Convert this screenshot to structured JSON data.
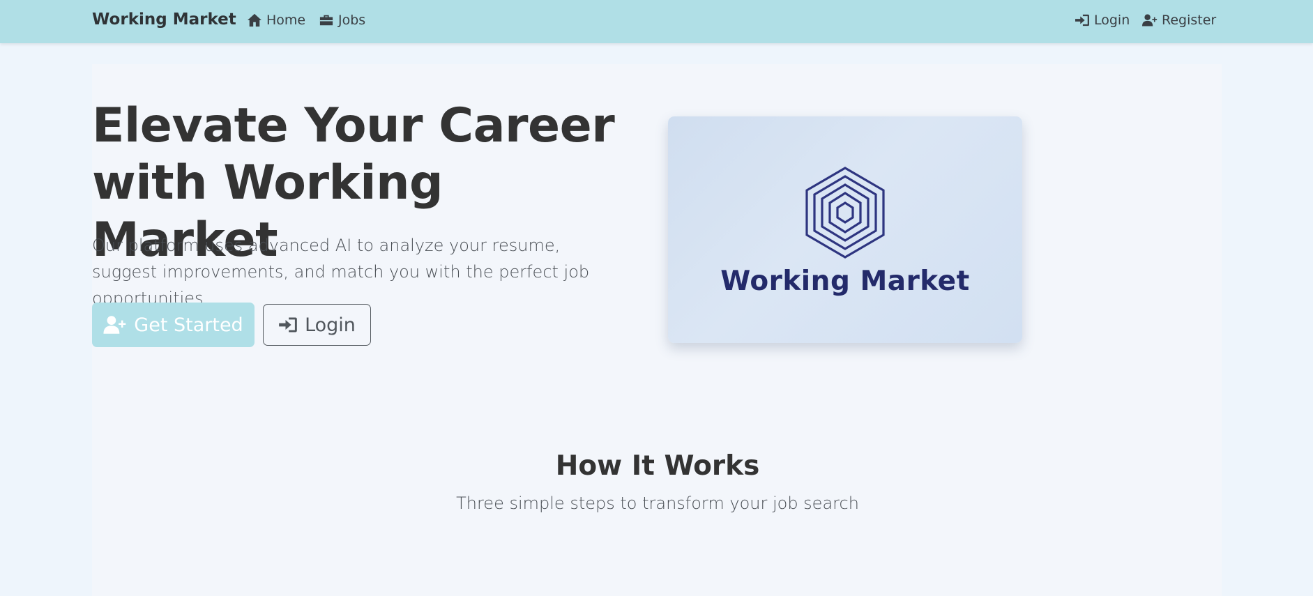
{
  "navbar": {
    "brand": "Working Market",
    "links": {
      "home": "Home",
      "jobs": "Jobs",
      "login": "Login",
      "register": "Register"
    }
  },
  "hero": {
    "title_line1": "Elevate Your Career",
    "title_line2": "with Working Market",
    "subtitle": "Our platform uses advanced AI to analyze your resume, suggest improvements, and match you with the perfect job opportunities.",
    "primary_button": "Get Started",
    "secondary_button": "Login",
    "logo_wordmark": "Working Market"
  },
  "how_it_works": {
    "title": "How It Works",
    "subtitle": "Three simple steps to transform your job search"
  },
  "colors": {
    "navbar_bg": "#b0dfe6",
    "page_bg": "#eef5fc",
    "panel_bg": "#f3f6fb",
    "logo_navy": "#232a6a",
    "primary_button_bg": "#afdfe7"
  },
  "icons": {
    "home": "home-icon",
    "jobs": "briefcase-icon",
    "login": "sign-in-icon",
    "register": "user-plus-icon"
  }
}
